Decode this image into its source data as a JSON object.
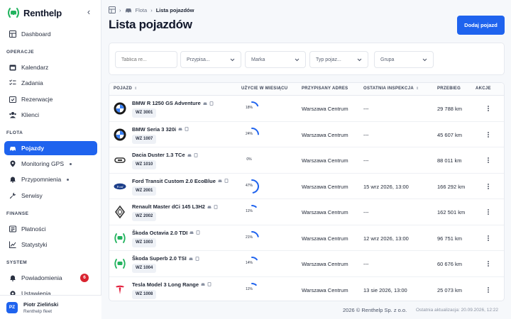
{
  "brand": {
    "name": "Renthelp"
  },
  "sidebar": {
    "dashboard": "Dashboard",
    "sections": [
      "OPERACJE",
      "FLOTA",
      "FINANSE",
      "SYSTEM"
    ],
    "items": [
      {
        "label": "Kalendarz",
        "icon": "calendar-icon"
      },
      {
        "label": "Zadania",
        "icon": "tasks-icon"
      },
      {
        "label": "Rezerwacje",
        "icon": "booking-icon"
      },
      {
        "label": "Klienci",
        "icon": "clients-icon"
      },
      {
        "label": "Pojazdy",
        "icon": "car-icon",
        "active": true
      },
      {
        "label": "Monitoring GPS",
        "icon": "gps-icon"
      },
      {
        "label": "Przypomnienia",
        "icon": "bell-icon"
      },
      {
        "label": "Serwisy",
        "icon": "wrench-icon"
      },
      {
        "label": "Płatności",
        "icon": "payments-icon"
      },
      {
        "label": "Statystyki",
        "icon": "stats-icon"
      },
      {
        "label": "Powiadomienia",
        "icon": "notification-icon",
        "badge": "6"
      },
      {
        "label": "Ustawienia",
        "icon": "settings-icon"
      }
    ],
    "user": {
      "initials": "PZ",
      "name": "Piotr Zieliński",
      "role": "Renthelp fleet"
    }
  },
  "breadcrumb": {
    "parent": "Flota",
    "current": "Lista pojazdów"
  },
  "page_title": "Lista pojazdów",
  "add_button": "Dodaj pojazd",
  "filters": {
    "plate_placeholder": "Tablica re...",
    "assigned": "Przypisa...",
    "make": "Marka",
    "type": "Typ pojaz...",
    "group": "Grupa"
  },
  "table": {
    "headers": {
      "vehicle": "POJAZD",
      "usage": "UŻYCIE W MIESIĄCU",
      "address": "PRZYPISANY ADRES",
      "inspection": "OSTATNIA INSPEKCJA",
      "mileage": "PRZEBIEG",
      "actions": "AKCJE"
    },
    "rows": [
      {
        "brand": "bmw",
        "name": "BMW R 1250 GS Adventure",
        "plate": "WZ 3001",
        "usage_label": "18%",
        "usage": 18,
        "address": "Warszawa Centrum",
        "inspection": "---",
        "mileage": "29 788 km"
      },
      {
        "brand": "bmw",
        "name": "BMW Seria 3 320i",
        "plate": "WZ 1007",
        "usage_label": "24%",
        "usage": 24,
        "address": "Warszawa Centrum",
        "inspection": "---",
        "mileage": "45 607 km"
      },
      {
        "brand": "dacia",
        "name": "Dacia Duster 1.3 TCe",
        "plate": "WZ 1010",
        "usage_label": "0%",
        "usage": 0,
        "address": "Warszawa Centrum",
        "inspection": "---",
        "mileage": "88 011 km"
      },
      {
        "brand": "ford",
        "name": "Ford Transit Custom 2.0 EcoBlue",
        "plate": "WZ 2001",
        "usage_label": "47%",
        "usage": 47,
        "address": "Warszawa Centrum",
        "inspection": "15 wrz 2026, 13:00",
        "mileage": "166 292 km"
      },
      {
        "brand": "renault",
        "name": "Renault Master dCi 145 L3H2",
        "plate": "WZ 2002",
        "usage_label": "11%",
        "usage": 11,
        "address": "Warszawa Centrum",
        "inspection": "---",
        "mileage": "162 501 km"
      },
      {
        "brand": "skoda",
        "name": "Škoda Octavia 2.0 TDI",
        "plate": "WZ 1003",
        "usage_label": "21%",
        "usage": 21,
        "address": "Warszawa Centrum",
        "inspection": "12 wrz 2026, 13:00",
        "mileage": "96 751 km"
      },
      {
        "brand": "skoda",
        "name": "Škoda Superb 2.0 TSI",
        "plate": "WZ 1004",
        "usage_label": "14%",
        "usage": 14,
        "address": "Warszawa Centrum",
        "inspection": "---",
        "mileage": "60 676 km"
      },
      {
        "brand": "tesla",
        "name": "Tesla Model 3 Long Range",
        "plate": "WZ 1008",
        "usage_label": "11%",
        "usage": 11,
        "address": "Warszawa Centrum",
        "inspection": "13 sie 2026, 13:00",
        "mileage": "25 073 km"
      }
    ]
  },
  "footer": {
    "copyright": "2026 © Renthelp Sp. z o.o.",
    "updated": "Ostatnia aktualizacja: 20.09.2026, 12:22"
  },
  "colors": {
    "accent": "#1f63ee",
    "badge": "#d9232f",
    "logo_green": "#22b35e"
  }
}
